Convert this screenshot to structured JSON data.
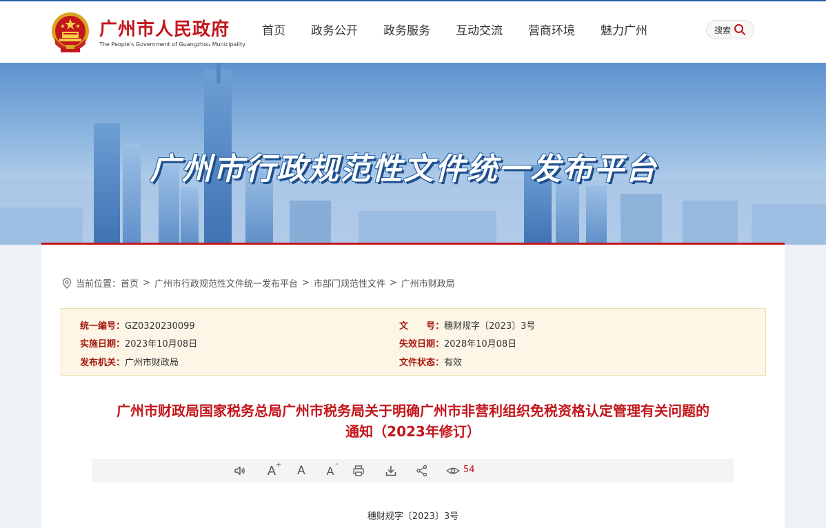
{
  "header": {
    "brand_cn": "广州市人民政府",
    "brand_en": "The People's Government of Guangzhou Municipality",
    "nav": [
      "首页",
      "政务公开",
      "政务服务",
      "互动交流",
      "营商环境",
      "魅力广州"
    ],
    "search_label": "搜索"
  },
  "banner": {
    "title": "广州市行政规范性文件统一发布平台"
  },
  "breadcrumb": {
    "prefix": "当前位置：",
    "items": [
      "首页",
      "广州市行政规范性文件统一发布平台",
      "市部门规范性文件",
      "广州市财政局"
    ],
    "separator": ">"
  },
  "meta": {
    "unified_no_key": "统一编号：",
    "unified_no": "GZ0320230099",
    "doc_no_key": "文　　号：",
    "doc_no": "穗财规字〔2023〕3号",
    "effective_key": "实施日期：",
    "effective": "2023年10月08日",
    "expiry_key": "失效日期：",
    "expiry": "2028年10月08日",
    "issuer_key": "发布机关：",
    "issuer": "广州市财政局",
    "status_key": "文件状态：",
    "status": "有效"
  },
  "document": {
    "title_line1": "广州市财政局国家税务总局广州市税务局关于明确广州市非营利组织免税资格认定管理有关问题的",
    "title_line2": "通知（2023年修订）",
    "number": "穗财规字〔2023〕3号"
  },
  "toolbar": {
    "view_count": "54",
    "font_large": "A",
    "font_mid": "A",
    "font_small": "A",
    "plus": "+",
    "minus": "-"
  },
  "colors": {
    "brand_red": "#c3161c",
    "key_red": "#a61b10",
    "meta_bg": "#fdf6e6",
    "nav_blue": "#2a5fa8"
  }
}
